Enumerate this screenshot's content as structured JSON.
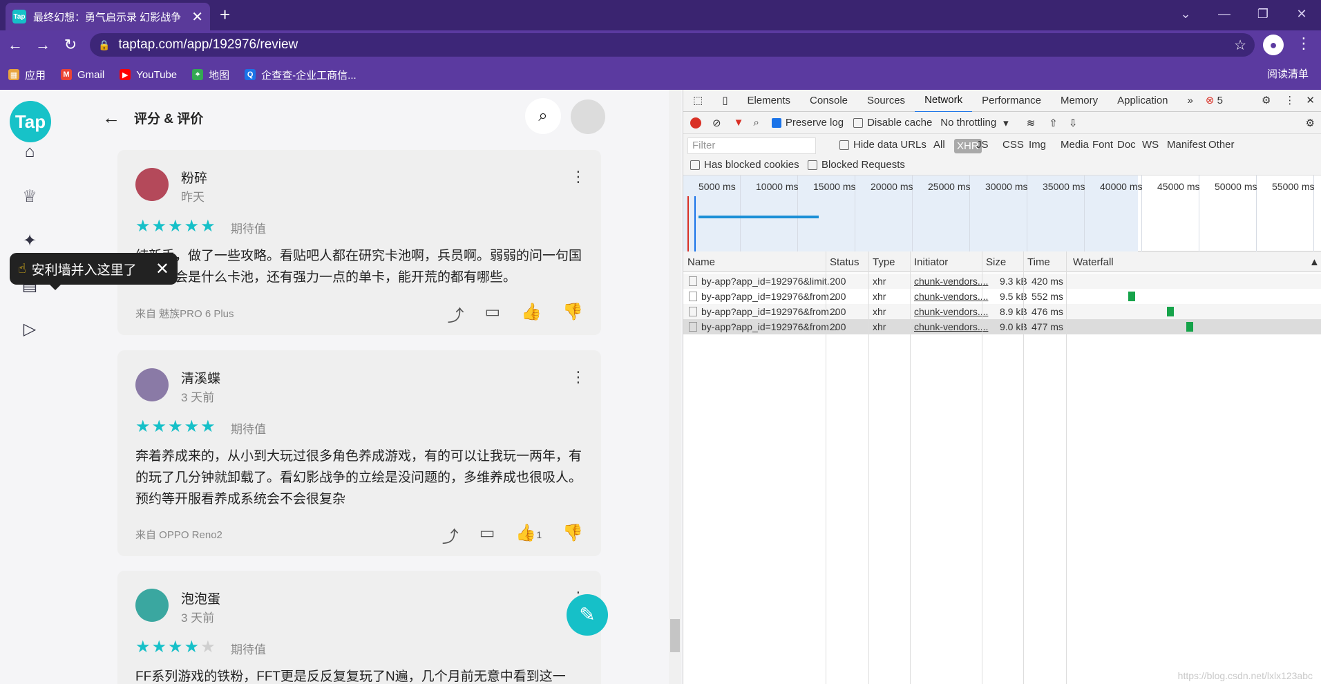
{
  "browser": {
    "tab_favicon": "Tap",
    "tab_title": "最终幻想：勇气启示录 幻影战争",
    "tab_close": "✕",
    "new_tab": "+",
    "url": "taptap.com/app/192976/review",
    "bookmarks": [
      {
        "label": "应用",
        "icon": "apps-icon",
        "glyph": "▦",
        "color": "#e8a33d"
      },
      {
        "label": "Gmail",
        "icon": "gmail-icon",
        "glyph": "M",
        "color": "#ea4335"
      },
      {
        "label": "YouTube",
        "icon": "youtube-icon",
        "glyph": "▶",
        "color": "#ff0000"
      },
      {
        "label": "地图",
        "icon": "maps-icon",
        "glyph": "⌖",
        "color": "#34a853"
      },
      {
        "label": "企查查-企业工商信...",
        "icon": "qcc-icon",
        "glyph": "Q",
        "color": "#1a73e8"
      }
    ],
    "reading_list": "阅读清单"
  },
  "page": {
    "title": "评分 & 评价",
    "toast": "安利墙并入这里了",
    "reviews": [
      {
        "name": "粉碎",
        "date": "昨天",
        "stars": 5,
        "expect": "期待值",
        "text": "纯新手，做了一些攻略。看贴吧人都在研究卡池啊，兵员啊。弱弱的问一句国服开服会是什么卡池，还有强力一点的单卡，能开荒的都有哪些。",
        "device": "来自 魅族PRO 6 Plus",
        "likes": "",
        "avatar_color": "#b4495a"
      },
      {
        "name": "清溪蝶",
        "date": "3 天前",
        "stars": 5,
        "expect": "期待值",
        "text": "奔着养成来的，从小到大玩过很多角色养成游戏，有的可以让我玩一两年，有的玩了几分钟就卸载了。看幻影战争的立绘是没问题的，多维养成也很吸人。预约等开服看养成系统会不会很复杂",
        "device": "来自 OPPO Reno2",
        "likes": "1",
        "avatar_color": "#8a7aa6"
      },
      {
        "name": "泡泡蛋",
        "date": "3 天前",
        "stars": 4,
        "expect": "期待值",
        "text": "FF系列游戏的铁粉，FFT更是反反复复玩了N遍，几个月前无意中看到这一",
        "device": "",
        "likes": "",
        "avatar_color": "#3aa7a0"
      }
    ]
  },
  "devtools": {
    "tabs": [
      "Elements",
      "Console",
      "Sources",
      "Network",
      "Performance",
      "Memory",
      "Application"
    ],
    "active_tab": "Network",
    "more_tabs": "»",
    "error_count": "5",
    "toolbar": {
      "preserve_log": "Preserve log",
      "disable_cache": "Disable cache",
      "throttling": "No throttling"
    },
    "filter": {
      "placeholder": "Filter",
      "hide_data_urls": "Hide data URLs",
      "types": [
        "All",
        "XHR",
        "JS",
        "CSS",
        "Img",
        "Media",
        "Font",
        "Doc",
        "WS",
        "Manifest",
        "Other"
      ],
      "active_type": "XHR",
      "has_blocked_cookies": "Has blocked cookies",
      "blocked_requests": "Blocked Requests"
    },
    "timeline_ticks": [
      "5000 ms",
      "10000 ms",
      "15000 ms",
      "20000 ms",
      "25000 ms",
      "30000 ms",
      "35000 ms",
      "40000 ms",
      "45000 ms",
      "50000 ms",
      "55000 ms"
    ],
    "columns": [
      "Name",
      "Status",
      "Type",
      "Initiator",
      "Size",
      "Time",
      "Waterfall"
    ],
    "rows": [
      {
        "name": "by-app?app_id=192976&limit...",
        "status": "200",
        "type": "xhr",
        "initiator": "chunk-vendors....",
        "size": "9.3 kB",
        "time": "420 ms"
      },
      {
        "name": "by-app?app_id=192976&from...",
        "status": "200",
        "type": "xhr",
        "initiator": "chunk-vendors....",
        "size": "9.5 kB",
        "time": "552 ms"
      },
      {
        "name": "by-app?app_id=192976&from...",
        "status": "200",
        "type": "xhr",
        "initiator": "chunk-vendors....",
        "size": "8.9 kB",
        "time": "476 ms"
      },
      {
        "name": "by-app?app_id=192976&from...",
        "status": "200",
        "type": "xhr",
        "initiator": "chunk-vendors....",
        "size": "9.0 kB",
        "time": "477 ms"
      }
    ]
  },
  "watermark": "https://blog.csdn.net/lxlx123abc"
}
